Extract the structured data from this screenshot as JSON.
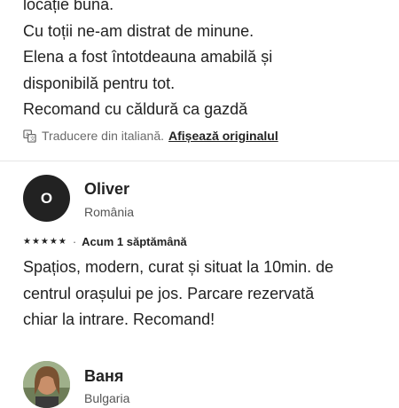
{
  "previous_review": {
    "lines": [
      "locație bună.",
      "Cu toții ne-am distrat de minune.",
      "Elena a fost întotdeauna amabilă și",
      "disponibilă pentru tot.",
      "Recomand cu căldură ca gazdă"
    ],
    "translation_note": "Traducere din italiană.",
    "show_original_link": "Afișează originalul"
  },
  "reviews": [
    {
      "avatar_initial": "O",
      "name": "Oliver",
      "country": "România",
      "stars": "★★★★★",
      "separator": "·",
      "time": "Acum 1 săptămână",
      "text_lines": [
        "Spațios, modern, curat și situat la 10min. de",
        "centrul orașului pe jos. Parcare rezervată",
        "chiar la intrare. Recomand!"
      ]
    },
    {
      "name": "Ваня",
      "country": "Bulgaria"
    }
  ],
  "colors": {
    "text": "#222222",
    "muted": "#6a6a6a",
    "avatar_bg": "#222222"
  }
}
